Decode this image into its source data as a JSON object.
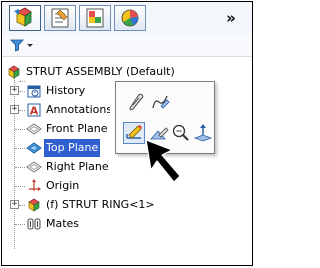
{
  "toolbar": {
    "tabs": [
      {
        "name": "featuremanager-tab",
        "icon": "featuremanager-icon",
        "active": true
      },
      {
        "name": "propertymanager-tab",
        "icon": "propertymanager-icon",
        "active": false
      },
      {
        "name": "configurationmanager-tab",
        "icon": "configurationmanager-icon",
        "active": false
      },
      {
        "name": "displaymanager-tab",
        "icon": "displaymanager-icon",
        "active": false
      }
    ],
    "more_label": "»"
  },
  "filter": {
    "icon": "filter-icon"
  },
  "tree": {
    "root_label": "STRUT ASSEMBLY  (Default)",
    "items": [
      {
        "label": "History",
        "icon": "history-icon",
        "expandable": true
      },
      {
        "label": "Annotations",
        "icon": "annotations-icon",
        "expandable": true
      },
      {
        "label": "Front Plane",
        "icon": "plane-icon",
        "expandable": false
      },
      {
        "label": "Top Plane",
        "icon": "plane-icon",
        "expandable": false,
        "selected": true
      },
      {
        "label": "Right Plane",
        "icon": "plane-icon",
        "expandable": false
      },
      {
        "label": "Origin",
        "icon": "origin-icon",
        "expandable": false
      },
      {
        "label": "(f) STRUT RING<1>",
        "icon": "part-icon",
        "expandable": true
      },
      {
        "label": "Mates",
        "icon": "mates-icon",
        "expandable": false
      }
    ]
  },
  "context_toolbar": {
    "buttons": [
      {
        "icon": "hide-icon"
      },
      {
        "icon": "edit-sketch-icon"
      },
      {
        "icon": "sketch-icon",
        "highlighted": true
      },
      {
        "icon": "edit-feature-icon"
      },
      {
        "icon": "zoom-to-selection-icon"
      },
      {
        "icon": "normal-to-icon"
      }
    ]
  },
  "colors": {
    "selection": "#2f5fd0",
    "accent": "#6f8fb8"
  }
}
